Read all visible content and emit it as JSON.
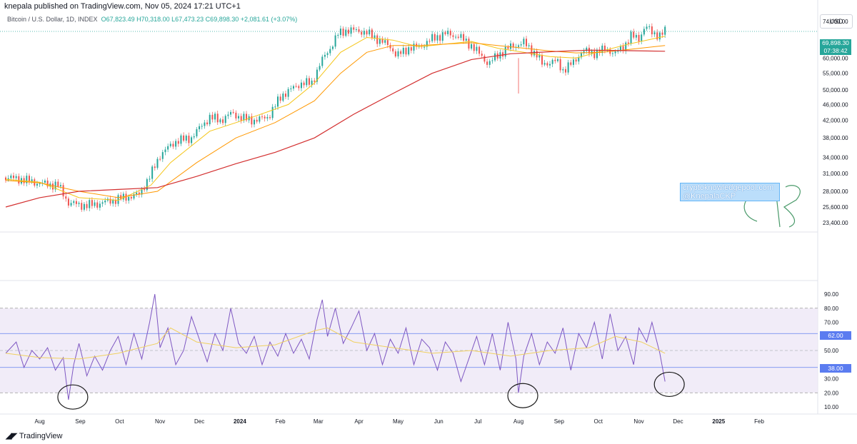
{
  "header": {
    "publish_line": "knepala published on TradingView.com, Nov 05, 2024 17:21 UTC+1"
  },
  "symbol_info": {
    "name": "Bitcoin / U.S. Dollar, 1D, INDEX",
    "ohlc": "O67,823.49 H70,318.00 L67,473.23 C69,898.30 +2,081.61 (+3.07%)"
  },
  "currency": "USD",
  "last_price": "69,898.30",
  "countdown": "07:38:42",
  "rsi_tags": {
    "upper": "62.00",
    "lower": "38.00"
  },
  "watermark": {
    "line1": "cryptoknowledgepool.com",
    "line2": "@KnepalaCKP"
  },
  "brand": "TradingView",
  "colors": {
    "up": "#26a69a",
    "down": "#ef5350",
    "ema_fast": "#f5c518",
    "ema_mid": "#ff9800",
    "ema_slow": "#d32f2f",
    "rsi": "#7e57c2",
    "rsi_band": "#ede7f6",
    "rsi_level": "#5b7cf0",
    "annotation": "#1a1a1a",
    "signature": "#4a9a6a"
  },
  "chart_data": [
    {
      "type": "line",
      "panel": "price",
      "title": "",
      "price_axis": [
        "74,000.00",
        "69,898.30",
        "64,000.00",
        "60,000.00",
        "55,000.00",
        "50,000.00",
        "46,000.00",
        "42,000.00",
        "38,000.00",
        "34,000.00",
        "31,000.00",
        "28,000.00",
        "25,600.00",
        "23,400.00"
      ],
      "log_scale": true,
      "ylim": [
        22000,
        76000
      ],
      "x_labels": [
        "Aug",
        "Sep",
        "Oct",
        "Nov",
        "Dec",
        "2024",
        "Feb",
        "Mar",
        "Apr",
        "May",
        "Jun",
        "Jul",
        "Aug",
        "Sep",
        "Oct",
        "Nov",
        "Dec",
        "2025",
        "Feb"
      ],
      "x_tick_days": [
        0,
        31,
        61,
        92,
        122,
        153,
        184,
        213,
        244,
        274,
        305,
        335,
        366,
        397,
        427,
        458,
        488,
        519,
        550
      ],
      "x_range_days": [
        -26,
        592
      ],
      "series": [
        {
          "name": "",
          "role": "close",
          "x": [
            -26,
            -14,
            0,
            14,
            22,
            35,
            45,
            60,
            76,
            85,
            92,
            105,
            115,
            130,
            138,
            147,
            155,
            165,
            175,
            185,
            200,
            208,
            215,
            222,
            228,
            235,
            248,
            258,
            268,
            273,
            283,
            290,
            300,
            310,
            320,
            330,
            343,
            350,
            360,
            370,
            380,
            384,
            395,
            400,
            408,
            415,
            424,
            433,
            440,
            447,
            452,
            458,
            463,
            468,
            474,
            478
          ],
          "y": [
            30300,
            30000,
            29300,
            29000,
            26200,
            25800,
            26100,
            26800,
            27500,
            30800,
            34500,
            37500,
            37800,
            42800,
            42000,
            43800,
            42500,
            42000,
            43000,
            48500,
            52000,
            52000,
            58700,
            63500,
            68800,
            70500,
            69800,
            67000,
            64000,
            60800,
            63800,
            63800,
            67000,
            69000,
            68000,
            64500,
            58000,
            61000,
            64000,
            65500,
            61000,
            58000,
            59000,
            56000,
            58500,
            62500,
            61800,
            63200,
            61500,
            64500,
            68000,
            67200,
            72000,
            69500,
            68300,
            69900
          ]
        },
        {
          "name": "",
          "role": "ema_fast",
          "x": [
            -26,
            0,
            30,
            60,
            85,
            100,
            130,
            160,
            190,
            210,
            230,
            250,
            270,
            290,
            310,
            330,
            350,
            370,
            390,
            410,
            430,
            450,
            478
          ],
          "y": [
            30000,
            29500,
            27000,
            26600,
            29000,
            33000,
            39500,
            42500,
            46000,
            52000,
            62000,
            67500,
            66500,
            64000,
            65000,
            66000,
            63500,
            62000,
            60500,
            60000,
            62500,
            65000,
            68000
          ]
        },
        {
          "name": "",
          "role": "ema_mid",
          "x": [
            -26,
            0,
            30,
            60,
            90,
            120,
            150,
            180,
            210,
            230,
            250,
            270,
            290,
            310,
            330,
            350,
            370,
            390,
            410,
            430,
            450,
            478
          ],
          "y": [
            29800,
            29400,
            28000,
            27000,
            28000,
            33000,
            38000,
            41500,
            47000,
            55000,
            62000,
            64500,
            64500,
            65000,
            65500,
            64500,
            63500,
            62500,
            61800,
            62000,
            63000,
            64500
          ]
        },
        {
          "name": "",
          "role": "ema_slow",
          "x": [
            -26,
            0,
            30,
            60,
            90,
            120,
            150,
            180,
            210,
            240,
            270,
            300,
            330,
            360,
            390,
            420,
            450,
            478
          ],
          "y": [
            25600,
            27000,
            28000,
            28300,
            28600,
            30500,
            32800,
            35000,
            38000,
            43500,
            49000,
            55000,
            59500,
            61500,
            62200,
            62800,
            62600,
            62400
          ]
        }
      ],
      "reference_line": 69898.3,
      "annotations": [
        "lowest wick Aug 2024",
        "handwritten signature"
      ]
    },
    {
      "type": "line",
      "panel": "rsi",
      "title": "",
      "y_axis": [
        "90.00",
        "80.00",
        "70.00",
        "62.00",
        "50.00",
        "38.00",
        "30.00",
        "20.00",
        "10.00"
      ],
      "ylim": [
        5,
        95
      ],
      "levels": {
        "band_top": 80,
        "band_bottom": 20,
        "middle": 50,
        "upper": 62,
        "lower": 38
      },
      "series": [
        {
          "name": "",
          "role": "rsi",
          "x": [
            -26,
            -18,
            -12,
            -6,
            0,
            6,
            12,
            18,
            22,
            26,
            30,
            36,
            42,
            48,
            54,
            60,
            66,
            72,
            78,
            84,
            88,
            92,
            98,
            104,
            110,
            116,
            122,
            128,
            134,
            140,
            146,
            152,
            158,
            164,
            170,
            176,
            182,
            188,
            194,
            200,
            206,
            212,
            216,
            220,
            226,
            232,
            238,
            244,
            250,
            256,
            262,
            268,
            274,
            280,
            286,
            292,
            298,
            304,
            310,
            316,
            322,
            328,
            334,
            340,
            346,
            352,
            358,
            364,
            366,
            370,
            376,
            382,
            388,
            394,
            400,
            406,
            412,
            418,
            424,
            430,
            436,
            442,
            448,
            454,
            458,
            464,
            468,
            474,
            478
          ],
          "y": [
            48,
            56,
            38,
            50,
            44,
            52,
            36,
            45,
            15,
            40,
            55,
            32,
            46,
            36,
            50,
            60,
            40,
            62,
            44,
            70,
            90,
            52,
            66,
            40,
            50,
            74,
            58,
            42,
            62,
            50,
            80,
            55,
            48,
            60,
            40,
            56,
            46,
            62,
            48,
            58,
            44,
            72,
            86,
            60,
            80,
            55,
            66,
            78,
            50,
            62,
            40,
            58,
            48,
            66,
            40,
            58,
            52,
            36,
            56,
            48,
            28,
            44,
            60,
            40,
            62,
            36,
            70,
            44,
            20,
            46,
            62,
            40,
            56,
            48,
            66,
            36,
            62,
            52,
            70,
            44,
            76,
            50,
            60,
            40,
            66,
            56,
            70,
            48,
            28
          ]
        },
        {
          "name": "",
          "role": "rsi_ma",
          "x": [
            -26,
            0,
            30,
            60,
            90,
            100,
            120,
            150,
            180,
            210,
            220,
            240,
            270,
            300,
            330,
            360,
            390,
            420,
            440,
            460,
            478
          ],
          "y": [
            48,
            45,
            44,
            48,
            55,
            66,
            56,
            52,
            54,
            64,
            66,
            56,
            52,
            48,
            50,
            46,
            50,
            52,
            60,
            56,
            48
          ]
        }
      ]
    }
  ]
}
